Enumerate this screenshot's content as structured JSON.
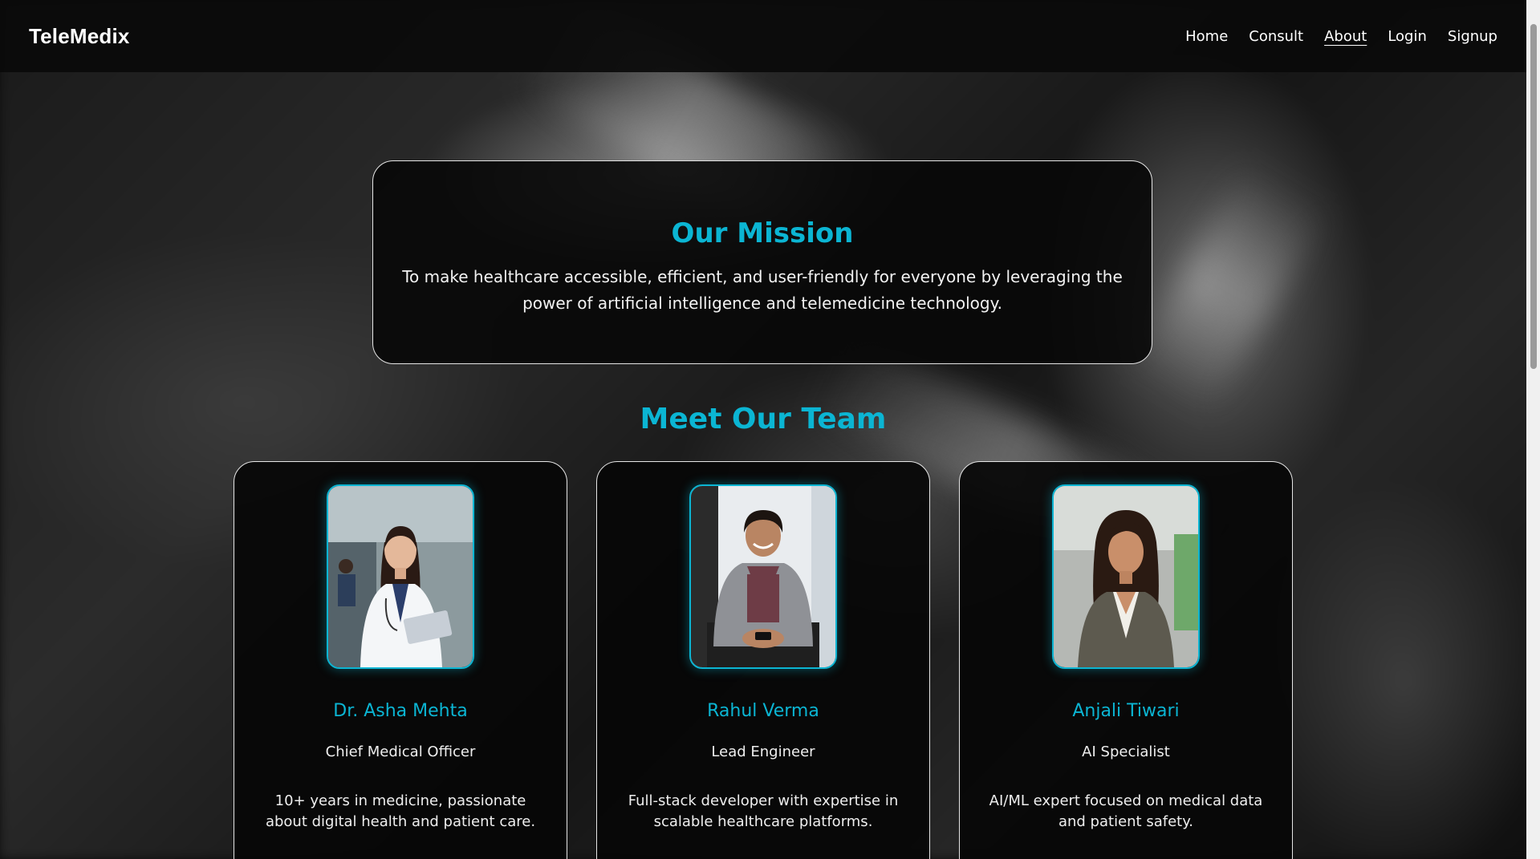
{
  "brand": "TeleMedix",
  "nav": {
    "items": [
      {
        "label": "Home",
        "active": false
      },
      {
        "label": "Consult",
        "active": false
      },
      {
        "label": "About",
        "active": true
      },
      {
        "label": "Login",
        "active": false
      },
      {
        "label": "Signup",
        "active": false
      }
    ]
  },
  "mission": {
    "title": "Our Mission",
    "text": "To make healthcare accessible, efficient, and user-friendly for everyone by leveraging the power of artificial intelligence and telemedicine technology."
  },
  "team": {
    "title": "Meet Our Team",
    "members": [
      {
        "name": "Dr. Asha Mehta",
        "role": "Chief Medical Officer",
        "bio": "10+ years in medicine, passionate about digital health and patient care.",
        "photo": "doctor-portrait"
      },
      {
        "name": "Rahul Verma",
        "role": "Lead Engineer",
        "bio": "Full-stack developer with expertise in scalable healthcare platforms.",
        "photo": "engineer-portrait"
      },
      {
        "name": "Anjali Tiwari",
        "role": "AI Specialist",
        "bio": "AI/ML expert focused on medical data and patient safety.",
        "photo": "specialist-portrait"
      }
    ]
  },
  "colors": {
    "accent": "#0bb5d3",
    "navbar": "#0a0a0a",
    "card_bg": "#060606",
    "border": "#e6e6e6"
  }
}
